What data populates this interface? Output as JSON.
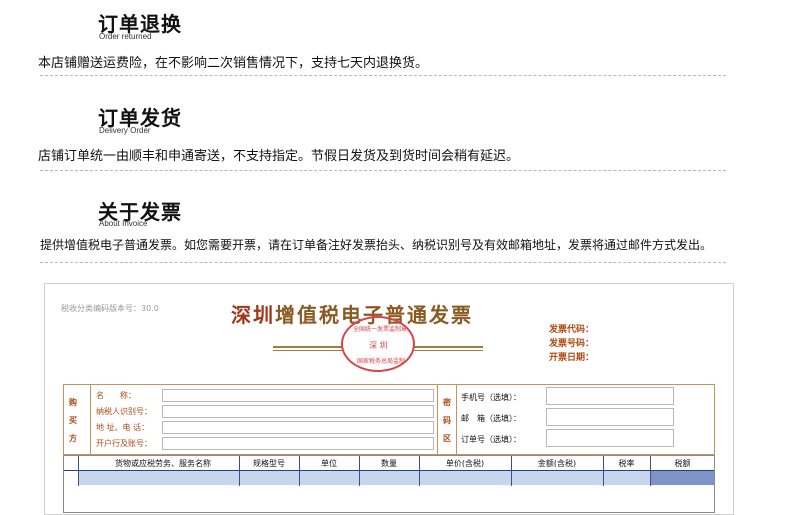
{
  "sections": [
    {
      "title": "订单退换",
      "subtitle": "Order returned",
      "text": "本店铺赠送运费险，在不影响二次销售情况下，支持七天内退换货。"
    },
    {
      "title": "订单发货",
      "subtitle": "Delivery Order",
      "text": "店铺订单统一由顺丰和申通寄送，不支持指定。节假日发货及到货时间会稍有延迟。"
    },
    {
      "title": "关于发票",
      "subtitle": "About Invoice",
      "text": "提供增值税电子普通发票。如您需要开票，请在订单备注好发票抬头、纳税识别号及有效邮箱地址，发票将通过邮件方式发出。"
    }
  ],
  "invoice": {
    "code_version": "税收分类编码版本号：30.0",
    "title_city": "深圳",
    "title_rest": "增值税电子普通发票",
    "seal_text": "深 圳",
    "seal_top": "全国统一发票监制章",
    "seal_bottom": "国家税务总局监制",
    "right_labels": [
      "发票代码：",
      "发票号码：",
      "开票日期："
    ],
    "buyer_side": [
      "购",
      "买",
      "方"
    ],
    "buyer_labels": [
      "名　　称：",
      "纳税人识别号：",
      "地 址、电 话：",
      "开户行及账号："
    ],
    "password_side": [
      "密",
      "码",
      "区"
    ],
    "contact_labels": [
      "手机号（选填）：",
      "邮　箱（选填）：",
      "订单号（选填）："
    ],
    "goods_headers": [
      "货物或应税劳务、服务名称",
      "规格型号",
      "单位",
      "数量",
      "单价(含税)",
      "金额(含税)",
      "税率",
      "税额"
    ]
  },
  "colors": {
    "accent": "#a0361a",
    "seal": "#d9434b",
    "table_header": "#2b3f7a"
  }
}
